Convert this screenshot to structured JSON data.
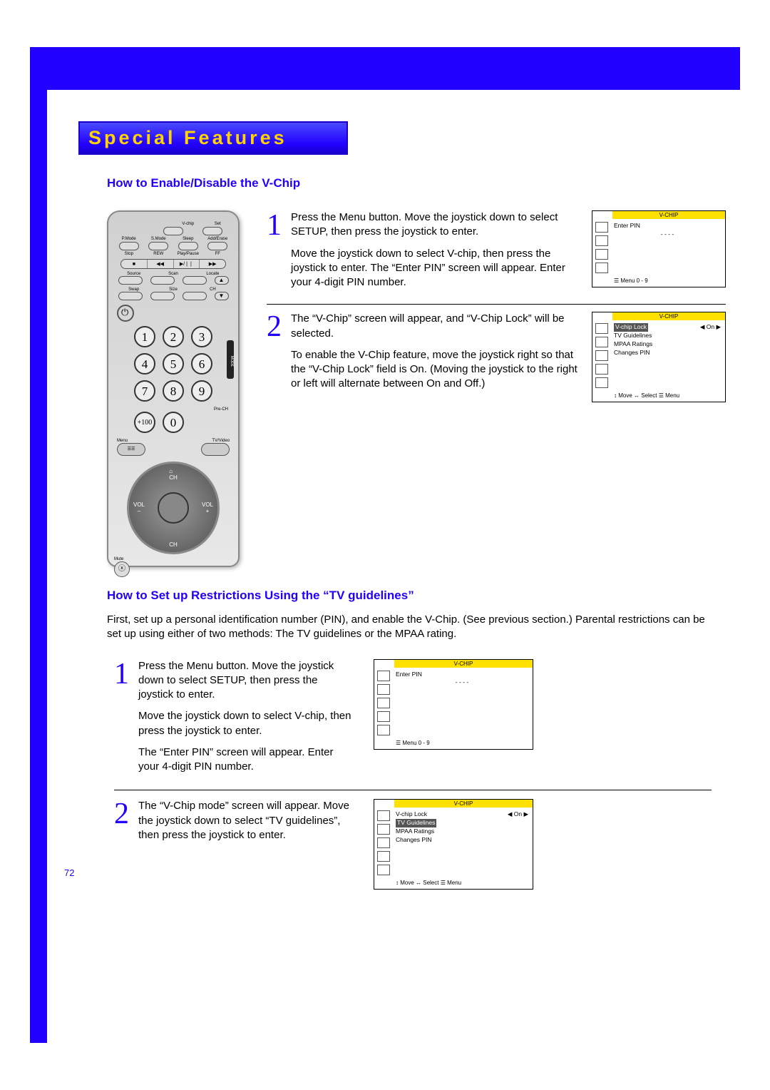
{
  "header": {
    "title": "Special Features"
  },
  "section1": {
    "heading": "How to Enable/Disable the V-Chip",
    "steps": [
      {
        "num": "1",
        "paras": [
          "Press the Menu button.  Move the joystick down to select SETUP, then press the joystick to enter.",
          "Move the joystick down to select V-chip, then press the joystick to enter.  The “Enter PIN” screen will appear.  Enter your 4-digit PIN number."
        ],
        "osd": {
          "title": "V-CHIP",
          "lines": [
            "Enter PIN",
            "- - - -"
          ],
          "footer": "☰ Menu       0 - 9"
        }
      },
      {
        "num": "2",
        "paras": [
          "The “V-Chip” screen will appear, and “V-Chip Lock” will be selected.",
          "To enable the V-Chip feature, move the joystick right so that the “V-Chip Lock” field is On.  (Moving the joystick to the right or left will alternate between On and Off.)"
        ],
        "osd": {
          "title": "V-CHIP",
          "rows": [
            {
              "label": "V-chip Lock",
              "value": "◀   On   ▶",
              "hl": true
            },
            {
              "label": "TV Guidelines"
            },
            {
              "label": "MPAA Ratings"
            },
            {
              "label": "Changes PIN"
            }
          ],
          "footer": "↕ Move   ↔ Select   ☰ Menu"
        }
      }
    ]
  },
  "section2": {
    "heading": "How to Set up Restrictions Using the “TV guidelines”",
    "intro": "First, set up a personal identification number (PIN), and enable the V-Chip. (See previous section.) Parental restrictions can be set up using either of two methods: The TV guidelines or the MPAA rating.",
    "steps": [
      {
        "num": "1",
        "paras": [
          "Press the Menu button.  Move the joystick down to select SETUP, then press the joystick to enter.",
          "Move the joystick down to select V-chip, then press the joystick to enter.",
          "The “Enter PIN” screen will appear.  Enter your 4-digit PIN number."
        ],
        "osd": {
          "title": "V-CHIP",
          "lines": [
            "Enter PIN",
            "- - - -"
          ],
          "footer": "☰ Menu       0 - 9"
        }
      },
      {
        "num": "2",
        "paras": [
          "The “V-Chip mode” screen will appear.  Move the joystick down to select “TV guidelines”, then press the joystick to enter."
        ],
        "osd": {
          "title": "V-CHIP",
          "rows": [
            {
              "label": "V-chip Lock",
              "value": "◀   On   ▶"
            },
            {
              "label": "TV Guidelines",
              "hl": true
            },
            {
              "label": "MPAA Ratings"
            },
            {
              "label": "Changes PIN"
            }
          ],
          "footer": "↕ Move   ↔ Select   ☰ Menu"
        }
      }
    ]
  },
  "remote": {
    "row_a": [
      "V-chip",
      "Set"
    ],
    "row_b": [
      "P.Mode",
      "S.Mode",
      "Sleep",
      "Add/Erase"
    ],
    "play_row": [
      "Stop",
      "REW",
      "Play/Pause",
      "FF"
    ],
    "play_sym": [
      "■",
      "◀◀",
      "▶/❘❘",
      "▶▶"
    ],
    "row_c": [
      "Source",
      "Scan",
      "Locate"
    ],
    "row_d": [
      "Swap",
      "Size",
      "CH"
    ],
    "row_e_sym": [
      "▲",
      "▼"
    ],
    "nums": [
      "1",
      "2",
      "3",
      "4",
      "5",
      "6",
      "7",
      "8",
      "9"
    ],
    "zero": "0",
    "plus100": "+100",
    "prech": "Pre-CH",
    "menu": "Menu",
    "tvvideo": "TV/Video",
    "menu_glyph": "☰☰",
    "joy": {
      "up": "CH",
      "down": "CH",
      "left": "VOL\n–",
      "right": "VOL\n+",
      "home": "⌂"
    },
    "mute": "Mute",
    "mute_sym": "ⓧ",
    "mode": "MODE"
  },
  "page_number": "72"
}
